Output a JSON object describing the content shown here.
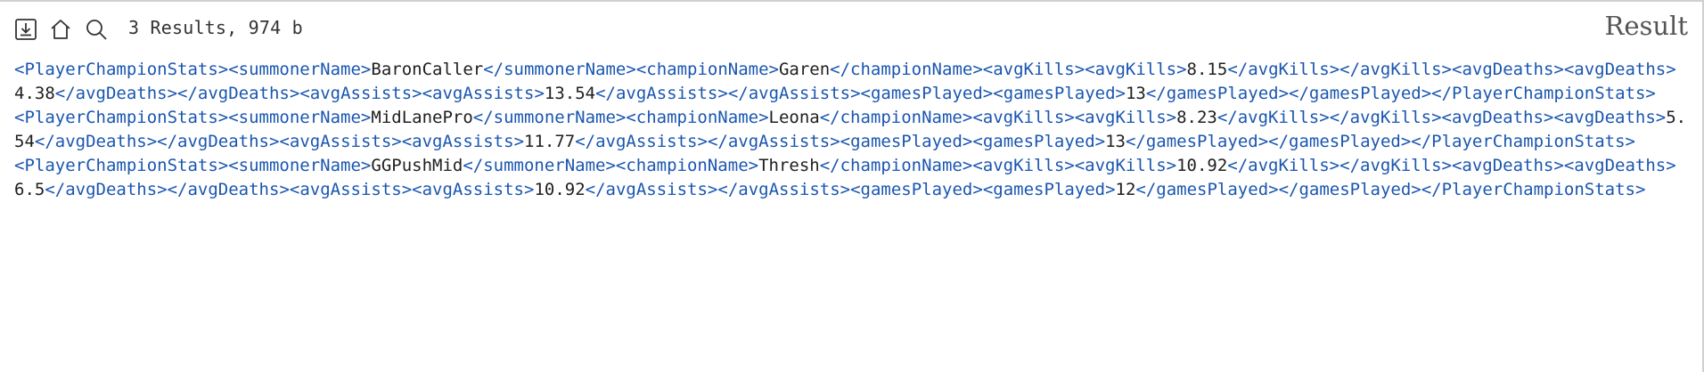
{
  "toolbar": {
    "results_label": "3 Results, 974 b",
    "title": "Result",
    "icons": [
      "download-icon",
      "home-icon",
      "search-icon"
    ]
  },
  "colors": {
    "tag": "#1a56b0",
    "value": "#202020",
    "border": "#d0d0d0"
  },
  "records": [
    {
      "summonerName": "BaronCaller",
      "championName": "Garen",
      "avgKills": "8.15",
      "avgDeaths": "4.38",
      "avgAssists": "13.54",
      "gamesPlayed": "13"
    },
    {
      "summonerName": "MidLanePro",
      "championName": "Leona",
      "avgKills": "8.23",
      "avgDeaths": "5.54",
      "avgAssists": "11.77",
      "gamesPlayed": "13"
    },
    {
      "summonerName": "GGPushMid",
      "championName": "Thresh",
      "avgKills": "10.92",
      "avgDeaths": "6.5",
      "avgAssists": "10.92",
      "gamesPlayed": "12"
    }
  ]
}
